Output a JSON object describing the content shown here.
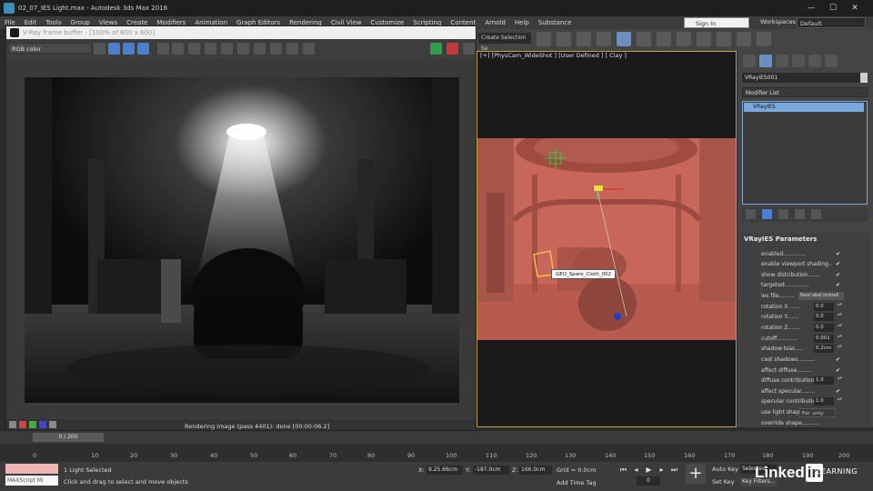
{
  "window": {
    "title": "02_07_IES Light.max - Autodesk 3ds Max 2018",
    "minimize": "—",
    "maximize": "☐",
    "close": "✕"
  },
  "menu": [
    "File",
    "Edit",
    "Tools",
    "Group",
    "Views",
    "Create",
    "Modifiers",
    "Animation",
    "Graph Editors",
    "Rendering",
    "Civil View",
    "Customize",
    "Scripting",
    "Content",
    "Arnold",
    "Help",
    "Substance"
  ],
  "signin": {
    "label": "Sign In"
  },
  "workspaces": {
    "label": "Workspaces:",
    "value": "Default"
  },
  "selection_set": "Create Selection Se",
  "vfb": {
    "title": "V-Ray frame buffer - [100% of 800 x 600]",
    "channel": "RGB color",
    "status": "Rendering image (pass 4401): done [00:00:06.2]"
  },
  "viewport": {
    "label": "[+] [PhysCam_WideShot ] [User Defined ] [ Clay ]",
    "tooltip": "GEO_Spare_Cloth_002"
  },
  "command_panel": {
    "object_name": "VRayIES001",
    "modifier_list": "Modifier List",
    "stack_item": "VRayIES",
    "rollout_title": "VRayIES Parameters",
    "params": [
      {
        "label": "enabled",
        "check": "✔"
      },
      {
        "label": "enable viewport shading",
        "check": "✔"
      },
      {
        "label": "show distribution",
        "check": "✔"
      },
      {
        "label": "targeted",
        "check": "✔"
      },
      {
        "label": "ies file",
        "file": "Nest.obel.lmbrell"
      },
      {
        "label": "rotation X",
        "value": "0.0"
      },
      {
        "label": "rotation Y",
        "value": "0.0"
      },
      {
        "label": "rotation Z",
        "value": "0.0"
      },
      {
        "label": "cutoff",
        "value": "0.001"
      },
      {
        "label": "shadow bias",
        "value": "0.2cm"
      },
      {
        "label": "cast shadows",
        "check": "✔"
      },
      {
        "label": "affect diffuse",
        "check": "✔"
      },
      {
        "label": "diffuse contribution",
        "value": "1.0"
      },
      {
        "label": "affect specular",
        "check": "✔"
      },
      {
        "label": "specular contribution",
        "value": "1.0"
      },
      {
        "label": "use light shape",
        "select": "For .only"
      },
      {
        "label": "override shape"
      }
    ]
  },
  "timeline": {
    "frame_counter": "0 / 200",
    "ticks": [
      "0",
      "10",
      "20",
      "30",
      "40",
      "50",
      "60",
      "70",
      "80",
      "90",
      "100",
      "110",
      "120",
      "130",
      "140",
      "150",
      "160",
      "170",
      "180",
      "190",
      "200"
    ]
  },
  "status": {
    "maxscript": "MAXScript Mi",
    "selection": "1 Light Selected",
    "prompt": "Click and drag to select and move objects",
    "x_label": "X:",
    "x_value": "9.25.66cm",
    "y_label": "Y:",
    "y_value": "-187.0cm",
    "z_label": "Z:",
    "z_value": "166.0cm",
    "grid": "Grid = 0.0cm",
    "add_time_tag": "Add Time Tag",
    "current_frame": "0",
    "auto_key": "Auto Key",
    "set_key": "Set Key",
    "selected": "Selected",
    "key_filters": "Key Filters..."
  },
  "branding": {
    "linkedin_text": "Linked",
    "linkedin_in": "in",
    "learning": "LEARNING"
  }
}
